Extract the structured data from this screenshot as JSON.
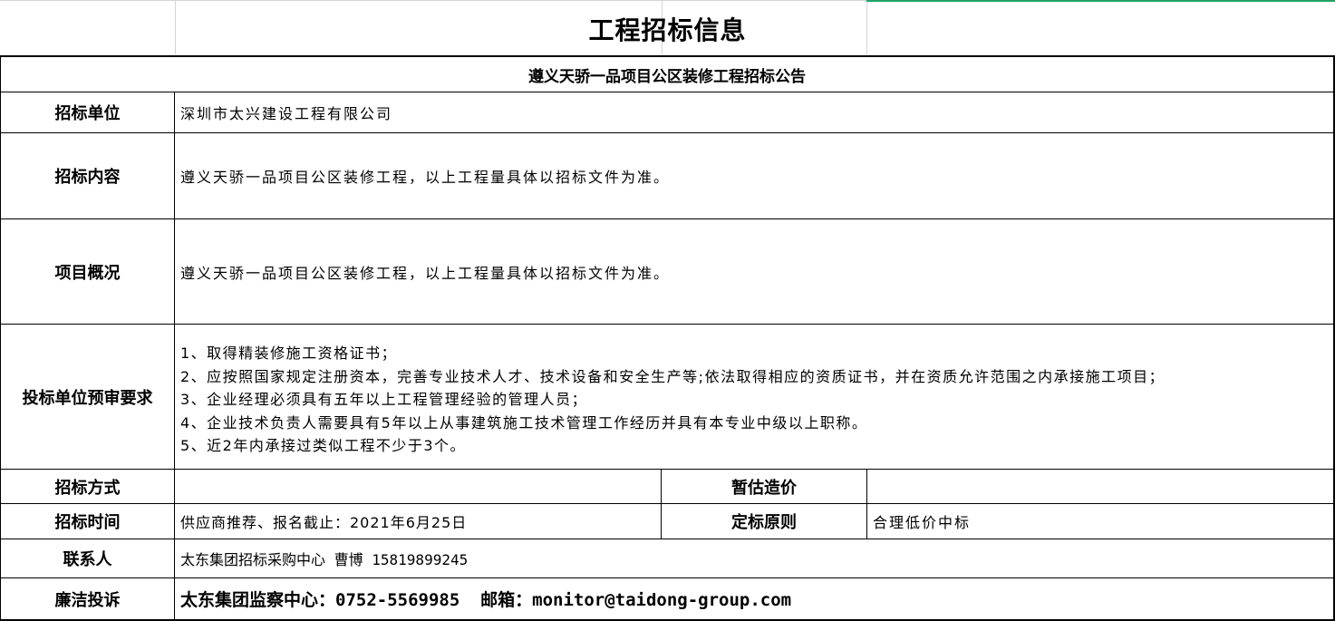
{
  "title": "工程招标信息",
  "announcement": "遵义天骄一品项目公区装修工程招标公告",
  "rows": {
    "unit": {
      "label": "招标单位",
      "value": "深圳市太兴建设工程有限公司"
    },
    "content": {
      "label": "招标内容",
      "value": "遵义天骄一品项目公区装修工程，以上工程量具体以招标文件为准。"
    },
    "overview": {
      "label": "项目概况",
      "value": "遵义天骄一品项目公区装修工程，以上工程量具体以招标文件为准。"
    },
    "requirements": {
      "label": "投标单位预审要求",
      "items": [
        "1、取得精装修施工资格证书；",
        "2、应按照国家规定注册资本，完善专业技术人才、技术设备和安全生产等;依法取得相应的资质证书，并在资质允许范围之内承接施工项目；",
        "3、企业经理必须具有五年以上工程管理经验的管理人员；",
        "4、企业技术负责人需要具有5年以上从事建筑施工技术管理工作经历并具有本专业中级以上职称。",
        "5、近2年内承接过类似工程不少于3个。"
      ]
    },
    "method": {
      "label": "招标方式",
      "value": "",
      "label2": "暂估造价",
      "value2": ""
    },
    "time": {
      "label": "招标时间",
      "value": "供应商推荐、报名截止：2021年6月25日",
      "label2": "定标原则",
      "value2": "合理低价中标"
    },
    "contact": {
      "label": "联系人",
      "value": "太东集团招标采购中心 曹博 15819899245"
    },
    "complaint": {
      "label": "廉洁投诉",
      "value": "太东集团监察中心：0752-5569985  邮箱：monitor@taidong-group.com"
    }
  }
}
